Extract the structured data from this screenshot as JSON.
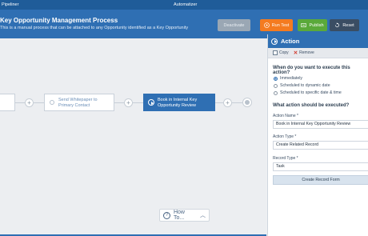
{
  "app": {
    "brand": "Pipeliner",
    "center_title": "Automatizer"
  },
  "header": {
    "title": "Key Opportunity Management Process",
    "subtitle": "This is a manual process that can be attached to any Opportunity identified as a Key Opportunity"
  },
  "buttons": {
    "deactivate": "Deactivate",
    "run_test": "Run Test",
    "publish": "Publish",
    "reset": "Reset"
  },
  "flow": {
    "nodes": [
      {
        "label": ""
      },
      {
        "label": "Send Whitepaper to Primary Contact"
      },
      {
        "label": "Book in Internal Key Opportunity Review"
      }
    ],
    "add_symbol": "+"
  },
  "howto": {
    "label": "How To...",
    "icon": "question-icon"
  },
  "panel": {
    "title": "Action",
    "tools": {
      "copy": "Copy",
      "remove": "Remove"
    },
    "when_question": "When do you want to execute this action?",
    "when_options": [
      {
        "label": "Immediately",
        "selected": true
      },
      {
        "label": "Scheduled to dynamic date",
        "selected": false
      },
      {
        "label": "Scheduled to specific date & time",
        "selected": false
      }
    ],
    "what_question": "What action should be executed?",
    "action_name_label": "Action Name *",
    "action_name_value": "Book in Internal Key Opportunity Review",
    "action_type_label": "Action Type *",
    "action_type_value": "Create Related Record",
    "record_type_label": "Record Type *",
    "record_type_value": "Task",
    "create_button": "Create Record Form"
  },
  "colors": {
    "primary": "#2f6fb3",
    "run_test": "#f47b20",
    "publish": "#5aa93a",
    "reset": "#3a4d63"
  }
}
